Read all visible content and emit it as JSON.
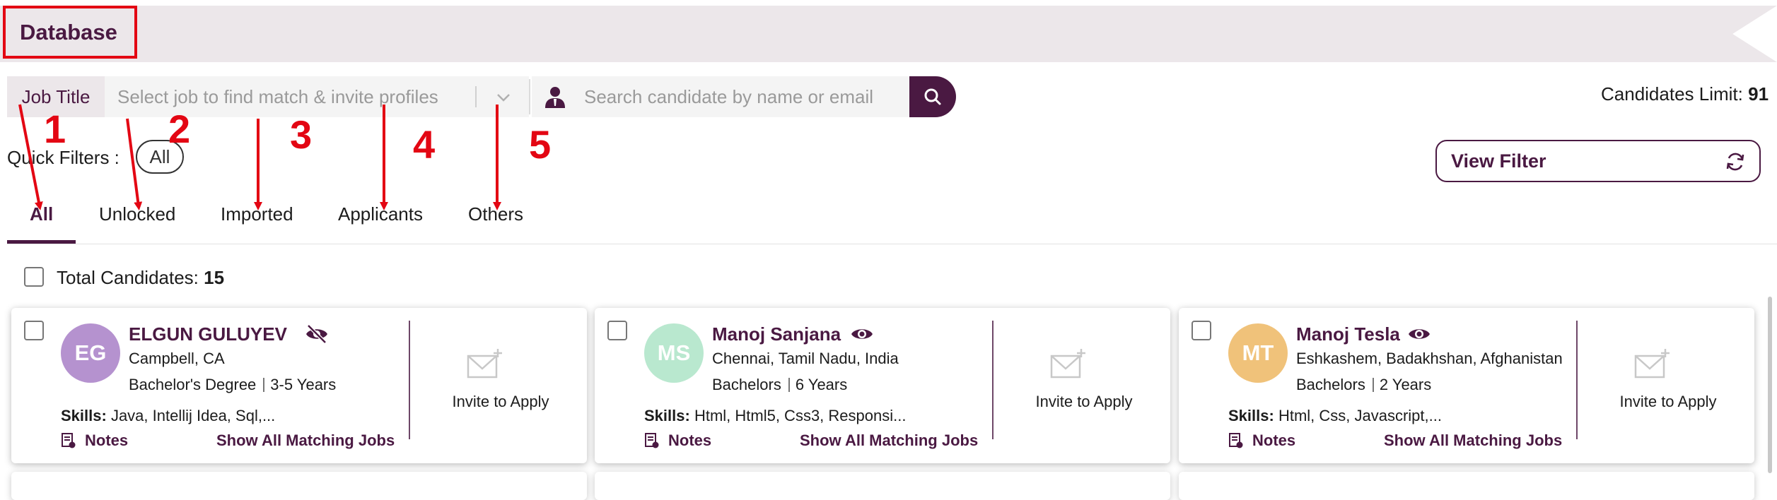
{
  "header": {
    "title": "Database"
  },
  "search": {
    "job_title_label": "Job Title",
    "job_placeholder": "Select job to find match & invite profiles",
    "candidate_placeholder": "Search candidate by name or email"
  },
  "candidates_limit": {
    "label": "Candidates Limit:",
    "value": "91"
  },
  "quick_filters": {
    "label": "Quick Filters :",
    "pill": "All"
  },
  "view_filter": {
    "label": "View Filter"
  },
  "tabs": [
    {
      "label": "All",
      "active": true
    },
    {
      "label": "Unlocked"
    },
    {
      "label": "Imported"
    },
    {
      "label": "Applicants"
    },
    {
      "label": "Others"
    }
  ],
  "total": {
    "label": "Total Candidates:",
    "value": "15"
  },
  "cards": [
    {
      "initials": "EG",
      "avatar_color": "#b592cf",
      "name": "ELGUN GULUYEV",
      "visibility_icon": "eye-slash-icon",
      "location": "Campbell, CA",
      "degree": "Bachelor's Degree",
      "experience": "3-5 Years",
      "skills_label": "Skills:",
      "skills": "Java, Intellij Idea, Sql,...",
      "notes_label": "Notes",
      "matching_label": "Show All Matching Jobs",
      "invite_label": "Invite to Apply"
    },
    {
      "initials": "MS",
      "avatar_color": "#b9e8cf",
      "name": "Manoj Sanjana",
      "visibility_icon": "eye-icon",
      "location": "Chennai, Tamil Nadu, India",
      "degree": "Bachelors",
      "experience": "6 Years",
      "skills_label": "Skills:",
      "skills": "Html, Html5, Css3, Responsi...",
      "notes_label": "Notes",
      "matching_label": "Show All Matching Jobs",
      "invite_label": "Invite to Apply"
    },
    {
      "initials": "MT",
      "avatar_color": "#f0c27a",
      "name": "Manoj Tesla",
      "visibility_icon": "eye-icon",
      "location": "Eshkashem, Badakhshan, Afghanistan",
      "degree": "Bachelors",
      "experience": "2 Years",
      "skills_label": "Skills:",
      "skills": "Html, Css, Javascript,...",
      "notes_label": "Notes",
      "matching_label": "Show All Matching Jobs",
      "invite_label": "Invite to Apply"
    }
  ],
  "annotations": [
    "1",
    "2",
    "3",
    "4",
    "5"
  ],
  "colors": {
    "brand": "#4a1942",
    "annotation": "#e30613",
    "banner": "#ece7ea"
  }
}
